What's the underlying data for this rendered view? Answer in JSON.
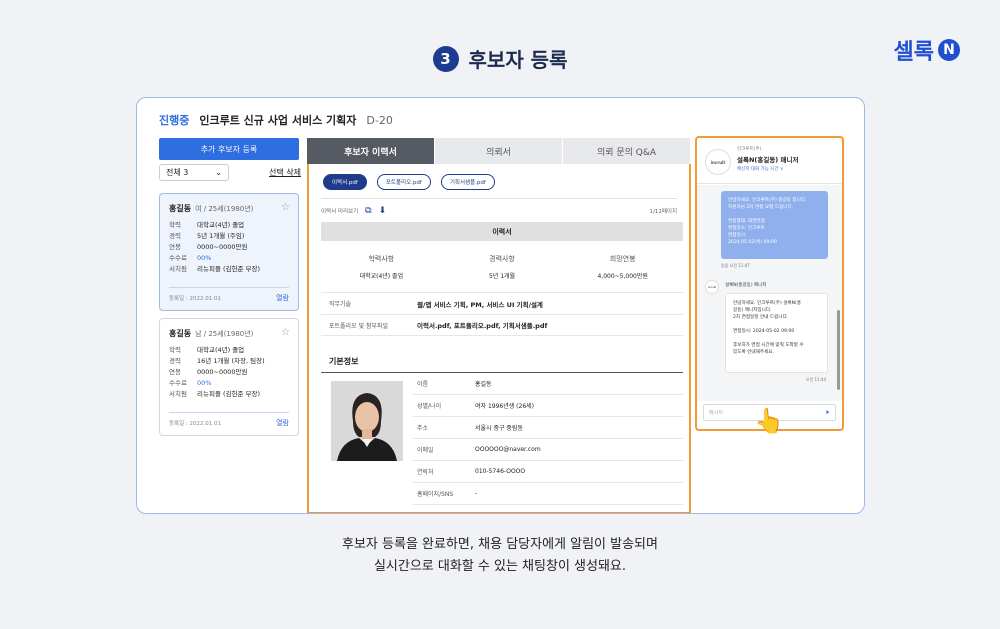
{
  "brand": {
    "name": "셀록",
    "mark": "N"
  },
  "step": {
    "number": "3",
    "title": "후보자 등록"
  },
  "job": {
    "status": "진행중",
    "title": "인크루트 신규 사업 서비스 기획자",
    "dday": "D-20"
  },
  "left": {
    "add_button": "추가 후보자 등록",
    "filter_value": "전체 3",
    "bulk_delete": "선택 삭제",
    "candidates": [
      {
        "name": "홍길동",
        "meta": "여 / 25세(1980년)",
        "rows": [
          {
            "k": "학력",
            "v": "대학교(4년) 졸업"
          },
          {
            "k": "경력",
            "v": "5년 1개월 (주임)"
          },
          {
            "k": "연봉",
            "v": "0000~0000만원"
          },
          {
            "k": "수수료",
            "v": "00%"
          },
          {
            "k": "서치펌",
            "v": "리뉴피플 (김헌준 부장)"
          }
        ],
        "date": "등록일 : 2022.01.01",
        "link": "열람"
      },
      {
        "name": "홍길동",
        "meta": "남 / 25세(1980년)",
        "rows": [
          {
            "k": "학력",
            "v": "대학교(4년) 졸업"
          },
          {
            "k": "경력",
            "v": "16년 1개월 (차장, 팀장)"
          },
          {
            "k": "연봉",
            "v": "0000~0000만원"
          },
          {
            "k": "수수료",
            "v": "00%"
          },
          {
            "k": "서치펌",
            "v": "리뉴피플 (김헌준 부장)"
          }
        ],
        "date": "등록일 : 2022.01.01",
        "link": "열람"
      }
    ]
  },
  "tabs": [
    "후보자 이력서",
    "의뢰서",
    "의뢰 문의 Q&A"
  ],
  "resume": {
    "files": [
      "이력서.pdf",
      "포트폴리오.pdf",
      "기획서샘플.pdf"
    ],
    "toolbar_label": "이력서 미리보기",
    "page": "1/12페이지",
    "section_title": "이력서",
    "summary": [
      {
        "k": "학력사항",
        "v": "대학교(4년) 졸업"
      },
      {
        "k": "경력사항",
        "v": "5년 1개월"
      },
      {
        "k": "희망연봉",
        "v": "4,000~5,000만원"
      }
    ],
    "details": [
      {
        "k": "직무기술",
        "v": "웹/앱 서비스 기획, PM, 서비스 UI 기획/설계"
      },
      {
        "k": "포트폴리오 및 첨부파일",
        "v": "이력서.pdf, 포트폴리오.pdf, 기획서샘플.pdf"
      }
    ],
    "basic_title": "기본정보",
    "basic_info": [
      {
        "k": "이름",
        "v": "홍길동"
      },
      {
        "k": "성별/나이",
        "v": "여자 1996년생 (26세)"
      },
      {
        "k": "주소",
        "v": "서울시 중구 중림동"
      },
      {
        "k": "이메일",
        "v": "OOOOOO@naver.com"
      },
      {
        "k": "연락처",
        "v": "010-5746-OOOO"
      },
      {
        "k": "홈페이지/SNS",
        "v": "-"
      }
    ]
  },
  "chat": {
    "org": "인크루트(주)",
    "logo": "incruit",
    "manager": "설록N(홍길동) 매니저",
    "availability": "메신저 대화 가능 시간 ∨",
    "out_message": "안녕하세요. 인크루트(주) 홍길동 입니다.\n지원자님 2차 면접 요청 드립니다.\n\n면접형태: 대면면접\n면접장소: 인크루트\n면접일시:\n2024.05.02(목) 09:00",
    "out_time": "읽음 오전 11:47",
    "in_sender": "설록N(홍길동) 매니저",
    "in_message": "안녕하세요. 인크루트(주) 설록N(홍\n길동) 매니저입니다.\n2차 면접일정 안내 드립니다.\n\n면접일시: 2024-05-02 09:00\n\n후보자가 면접 시간에 맞춰 도착할 수\n있도록 안내해주세요.",
    "in_time": "오전 11:44",
    "input_placeholder": "메시지"
  },
  "caption": {
    "line1": "후보자 등록을 완료하면, 채용 담당자에게 알림이 발송되며",
    "line2": "실시간으로 대화할 수 있는 채팅창이 생성돼요."
  }
}
